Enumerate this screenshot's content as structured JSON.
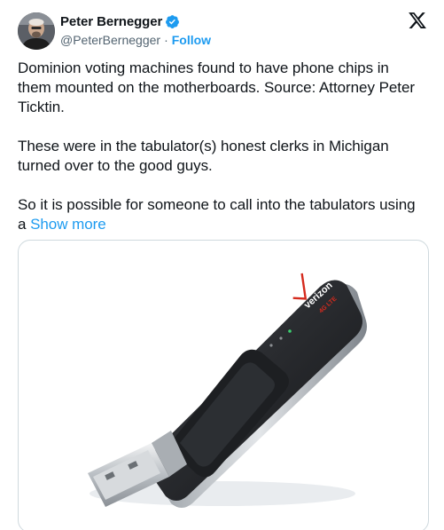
{
  "author": {
    "display_name": "Peter Bernegger",
    "handle": "@PeterBernegger",
    "separator": "·",
    "follow_label": "Follow"
  },
  "tweet": {
    "para1": "Dominion voting machines found to have phone chips in them mounted on the motherboards. Source: Attorney Peter Ticktin.",
    "para2": "These were in the tabulator(s) honest clerks in Michigan turned over to the good guys.",
    "para3": "So it is possible for someone to call into the tabulators using a",
    "show_more_label": "Show more"
  },
  "media": {
    "brand_text": "verizon",
    "sub_text": "4G LTE"
  },
  "colors": {
    "accent": "#1d9bf0",
    "text": "#0f1419",
    "secondary": "#536471",
    "brand": "#d52b1e"
  },
  "icons": [
    "avatar",
    "verified-badge-icon",
    "x-logo-icon"
  ]
}
